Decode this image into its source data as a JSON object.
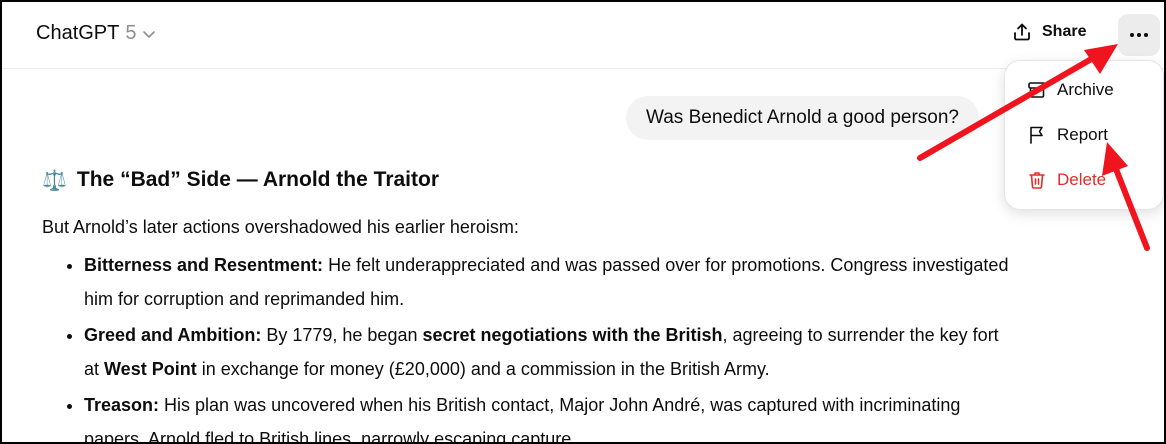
{
  "header": {
    "model_name": "ChatGPT",
    "model_version": "5",
    "share_label": "Share"
  },
  "menu": {
    "items": [
      {
        "label": "Archive"
      },
      {
        "label": "Report"
      },
      {
        "label": "Delete"
      }
    ]
  },
  "user_message": "Was Benedict Arnold a good person?",
  "response": {
    "heading_emoji": "⚖️",
    "heading": "The “Bad” Side — Arnold the Traitor",
    "intro": "But Arnold’s later actions overshadowed his earlier heroism:",
    "bullets": [
      {
        "label": "Bitterness and Resentment:",
        "text": " He felt underappreciated and was passed over for promotions. Congress investigated him for corruption and reprimanded him."
      },
      {
        "label": "Greed and Ambition:",
        "text_a": " By 1779, he began ",
        "bold_a": "secret negotiations with the British",
        "text_b": ", agreeing to surrender the key fort at ",
        "bold_b": "West Point",
        "text_c": " in exchange for money (£20,000) and a commission in the British Army."
      },
      {
        "label": "Treason:",
        "text": " His plan was uncovered when his British contact, Major John André, was captured with incriminating papers. Arnold fled to British lines, narrowly escaping capture."
      }
    ]
  },
  "colors": {
    "delete": "#e02e2a",
    "annotation_arrow": "#f0141e",
    "bubble": "#f3f3f3"
  }
}
